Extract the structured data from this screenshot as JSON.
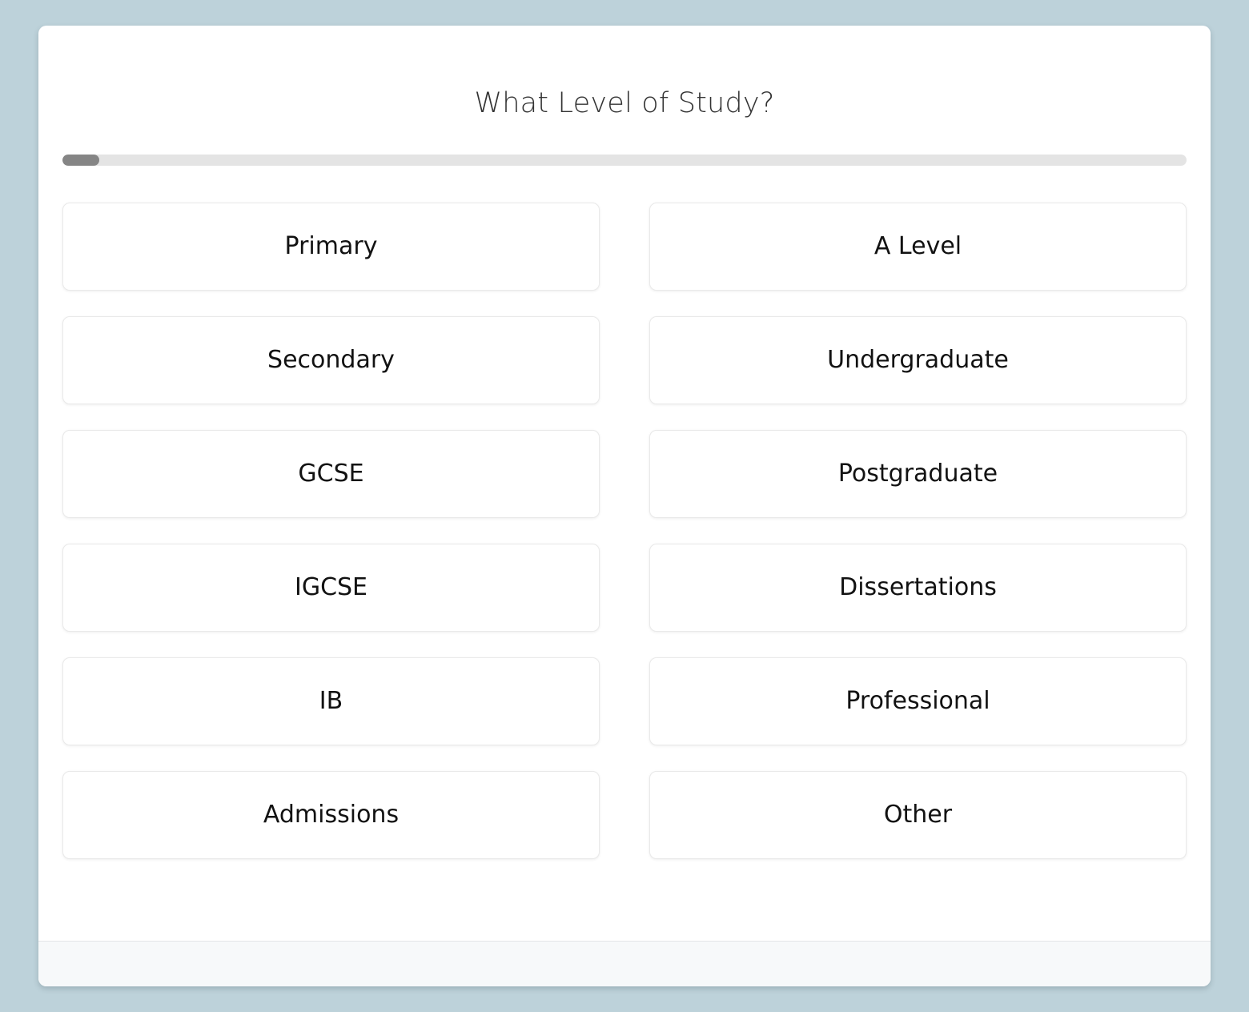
{
  "colors": {
    "page_background": "#bdd2da",
    "card_background": "#ffffff",
    "progress_track": "#e4e4e4",
    "progress_fill": "#858585",
    "option_border": "#e9e9e9",
    "option_text": "#121212",
    "title_text": "#333333",
    "footer_background": "#f7f9fa"
  },
  "card": {
    "title": "What Level of Study?",
    "progress": {
      "value_percent": 3.3,
      "label": ""
    },
    "options": [
      {
        "label": "Primary",
        "column": "left",
        "row": 1
      },
      {
        "label": "Secondary",
        "column": "left",
        "row": 2
      },
      {
        "label": "GCSE",
        "column": "left",
        "row": 3
      },
      {
        "label": "IGCSE",
        "column": "left",
        "row": 4
      },
      {
        "label": "IB",
        "column": "left",
        "row": 5
      },
      {
        "label": "Admissions",
        "column": "left",
        "row": 6
      },
      {
        "label": "A Level",
        "column": "right",
        "row": 1
      },
      {
        "label": "Undergraduate",
        "column": "right",
        "row": 2
      },
      {
        "label": "Postgraduate",
        "column": "right",
        "row": 3
      },
      {
        "label": "Dissertations",
        "column": "right",
        "row": 4
      },
      {
        "label": "Professional",
        "column": "right",
        "row": 5
      },
      {
        "label": "Other",
        "column": "right",
        "row": 6
      }
    ],
    "footer": {
      "content": ""
    }
  }
}
